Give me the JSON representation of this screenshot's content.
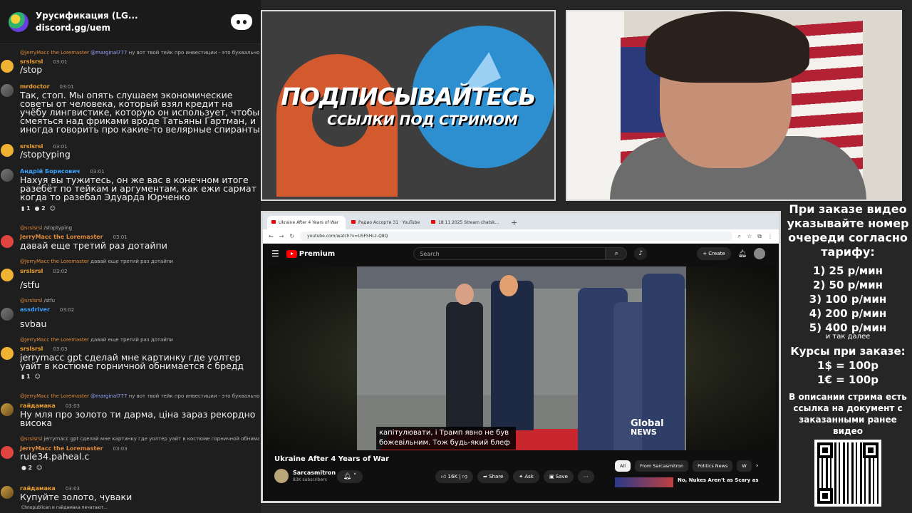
{
  "chat": {
    "server_name": "Урусификация (LG...",
    "invite": "discord.gg/uem",
    "messages": [
      {
        "reply_name": "@JerryMacc the Loremaster",
        "reply_mention": "@marginal777",
        "reply_text": "ну вот твой тейк про инвестиции - это буквально тейк",
        "user": "srslsrsl",
        "user_color": "#f0a030",
        "time": "03:01",
        "text": "/stop"
      },
      {
        "user": "mrdoctor",
        "user_color": "#f0a030",
        "time": "03:01",
        "text": "Так, стоп. Мы опять слушаем экономические советы от человека, который взял кредит на учёбу лингвистике, которую он использует, чтобы смеяться над фриками вроде Татьяны Гартман, и иногда говорить про какие-то велярные спиранты на стримах"
      },
      {
        "user": "srslsrsl",
        "user_color": "#f0a030",
        "time": "03:01",
        "text": "/stoptyping"
      },
      {
        "user": "Андрій Борисович",
        "user_color": "#3aa0ff",
        "time": "03:01",
        "text": "Нахуя вы тужитесь, он же вас в конечном итоге разебёт по тейкам и аргументам, как ежи сармат когда то разебал Эдуарда Юрченко",
        "reactions": [
          "1",
          "2"
        ]
      },
      {
        "reply_name": "@srslsrsl",
        "reply_text": "/stoptyping",
        "user": "JerryMacc the Loremaster",
        "user_color": "#e08a3c",
        "time": "03:01",
        "text": "давай еще третий раз дотайпи"
      },
      {
        "reply_name": "@JerryMacc the Loremaster",
        "reply_text": "давай еще третий раз дотайпи",
        "user": "srslsrsl",
        "user_color": "#f0a030",
        "time": "03:02",
        "text": "/stfu"
      },
      {
        "reply_name": "@srslsrsl",
        "reply_text": "/stfu",
        "user": "assdriver",
        "user_color": "#3aa0ff",
        "time": "03:02",
        "text": "svbau"
      },
      {
        "reply_name": "@JerryMacc the Loremaster",
        "reply_text": "давай еще третий раз дотайпи",
        "user": "srslsrsl",
        "user_color": "#f0a030",
        "time": "03:03",
        "text": "jerrymacc gpt сделай мне картинку где уолтер уайт в костюме горничной обнимается с бредд питтом",
        "reactions": [
          "1"
        ]
      },
      {
        "reply_name": "@JerryMacc the Loremaster",
        "reply_mention": "@marginal777",
        "reply_text": "ну вот твой тейк про инвестиции - это буквально тейк",
        "user": "гайдамака",
        "user_color": "#f0a030",
        "time": "03:03",
        "text": "Ну мля про золото ти дарма, ціна зараз рекордно висока"
      },
      {
        "reply_name": "@srslsrsl",
        "reply_text": "jerrymacc gpt сделай мне картинку где уолтер уайт в костюме горничной обнимается с",
        "user": "JerryMacc the Loremaster",
        "user_color": "#e08a3c",
        "time": "03:03",
        "text": "rule34.paheal.c",
        "reactions": [
          "2"
        ]
      },
      {
        "user": "гайдамака",
        "user_color": "#f0a030",
        "time": "03:03",
        "text": "Купуйте золото, чуваки"
      }
    ],
    "typing": "Chnopublican и гайдамака печатают..."
  },
  "promo": {
    "title": "ПОДПИСЫВАЙТЕСЬ",
    "subtitle": "ССЫЛКИ ПОД СТРИМОМ"
  },
  "browser": {
    "tabs": [
      "Ukraine After 4 Years of War",
      "Радио Ассорти 31 · YouTube",
      "18 11 2025 Stream chatsk..."
    ],
    "url": "youtube.com/watch?v=U5FSHLz-Q8Q",
    "yt": {
      "logo": "Premium",
      "search_placeholder": "Search",
      "create": "+ Create",
      "subtitle_line1": "капітулювати, і Трамп явно не був",
      "subtitle_line2": "божевільним.  Тож будь-який блеф",
      "news_l1": "Global",
      "news_l2": "NEWS",
      "video_title": "Ukraine After 4 Years of War",
      "channel": "Sarcasmitron",
      "channel_subs": "83K subscribers",
      "likes": "16K",
      "share": "Share",
      "ask": "Ask",
      "save": "Save",
      "chips": [
        "All",
        "From Sarcasmitron",
        "Politics News",
        "W"
      ],
      "rec_title": "No, Nukes Aren't as Scary as"
    }
  },
  "price": {
    "heading": "При заказе видео указывайте номер очереди согласно тарифу:",
    "tiers": [
      "1) 25 р/мин",
      "2) 50 р/мин",
      "3) 100 р/мин",
      "4) 200 р/мин",
      "5) 400 р/мин"
    ],
    "note": "и так далее",
    "course_heading": "Курсы при заказе:",
    "courses": [
      "1$ = 100р",
      "1€ = 100р"
    ],
    "description": "В описании стрима есть ссылка на документ с заказанными ранее видео"
  }
}
